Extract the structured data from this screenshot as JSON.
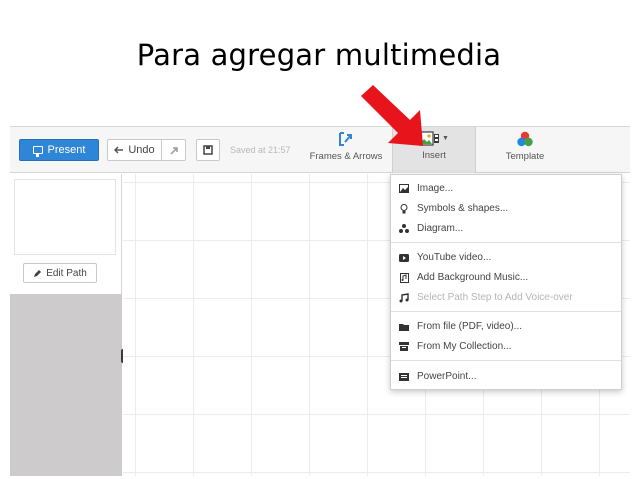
{
  "slide": {
    "title": "Para agregar multimedia"
  },
  "toolbar": {
    "present_label": "Present",
    "undo_label": "Undo",
    "saved_text": "Saved at 21:57",
    "frames_label": "Frames & Arrows",
    "insert_label": "Insert",
    "template_label": "Template"
  },
  "sidebar": {
    "edit_path_label": "Edit Path"
  },
  "insert_menu": {
    "items": [
      {
        "label": "Image...",
        "icon": "image-icon"
      },
      {
        "label": "Symbols & shapes...",
        "icon": "lightbulb-icon"
      },
      {
        "label": "Diagram...",
        "icon": "diagram-icon"
      },
      {
        "label": "YouTube video...",
        "icon": "youtube-icon"
      },
      {
        "label": "Add Background Music...",
        "icon": "music-file-icon"
      },
      {
        "label": "Select Path Step to Add Voice-over",
        "icon": "music-note-icon",
        "disabled": true
      },
      {
        "label": "From file (PDF, video)...",
        "icon": "folder-icon"
      },
      {
        "label": "From My Collection...",
        "icon": "collection-icon"
      },
      {
        "label": "PowerPoint...",
        "icon": "powerpoint-icon"
      }
    ]
  },
  "colors": {
    "accent": "#2f86d6",
    "arrow": "#e8141b",
    "sidebar_gray": "#cdcbcb"
  }
}
